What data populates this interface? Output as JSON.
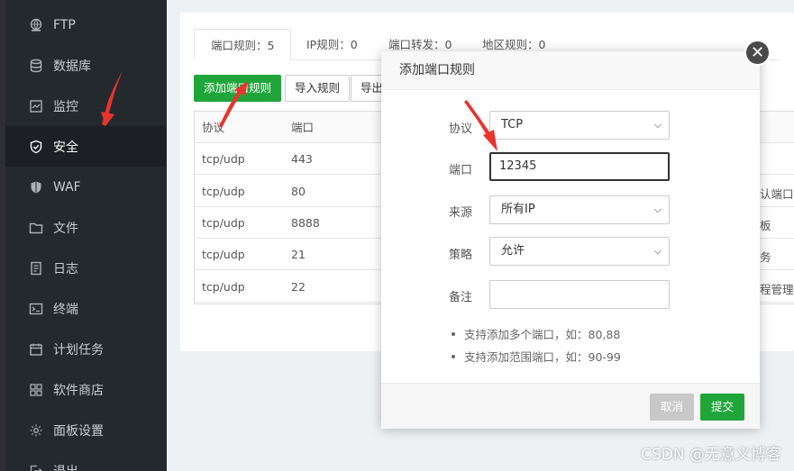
{
  "sidebar": {
    "items": [
      {
        "label": "FTP",
        "icon": "ftp-icon"
      },
      {
        "label": "数据库",
        "icon": "database-icon"
      },
      {
        "label": "监控",
        "icon": "monitor-icon"
      },
      {
        "label": "安全",
        "icon": "shield-icon",
        "active": true
      },
      {
        "label": "WAF",
        "icon": "waf-shield-icon"
      },
      {
        "label": "文件",
        "icon": "folder-icon"
      },
      {
        "label": "日志",
        "icon": "log-icon"
      },
      {
        "label": "终端",
        "icon": "terminal-icon"
      },
      {
        "label": "计划任务",
        "icon": "calendar-icon"
      },
      {
        "label": "软件商店",
        "icon": "apps-grid-icon"
      },
      {
        "label": "面板设置",
        "icon": "gear-icon"
      },
      {
        "label": "退出",
        "icon": "logout-icon"
      }
    ]
  },
  "tabs": [
    {
      "label": "端口规则：5"
    },
    {
      "label": "IP规则：0"
    },
    {
      "label": "端口转发：0"
    },
    {
      "label": "地区规则：0"
    }
  ],
  "toolbar": {
    "add_port_rule": "添加端口规则",
    "import_rules": "导入规则",
    "export_rules": "导出"
  },
  "table": {
    "columns": [
      "协议",
      "端口"
    ],
    "rows": [
      {
        "protocol": "tcp/udp",
        "port": "443",
        "note": ""
      },
      {
        "protocol": "tcp/udp",
        "port": "80",
        "note": "认端口"
      },
      {
        "protocol": "tcp/udp",
        "port": "8888",
        "note": "板"
      },
      {
        "protocol": "tcp/udp",
        "port": "21",
        "note": "务"
      },
      {
        "protocol": "tcp/udp",
        "port": "22",
        "note": "程管理服"
      }
    ]
  },
  "modal": {
    "title": "添加端口规则",
    "protocol_label": "协议",
    "protocol_value": "TCP",
    "port_label": "端口",
    "port_value": "12345",
    "source_label": "来源",
    "source_value": "所有IP",
    "policy_label": "策略",
    "policy_value": "允许",
    "remark_label": "备注",
    "remark_value": "",
    "tips": [
      "支持添加多个端口，如：80,88",
      "支持添加范围端口，如：90-99"
    ],
    "cancel_label": "取消",
    "submit_label": "提交"
  },
  "colors": {
    "accent_green": "#20a53a",
    "sidebar_bg": "#24292e",
    "arrow_red": "#e8342f"
  },
  "watermark": "CSDN @无意义博客"
}
